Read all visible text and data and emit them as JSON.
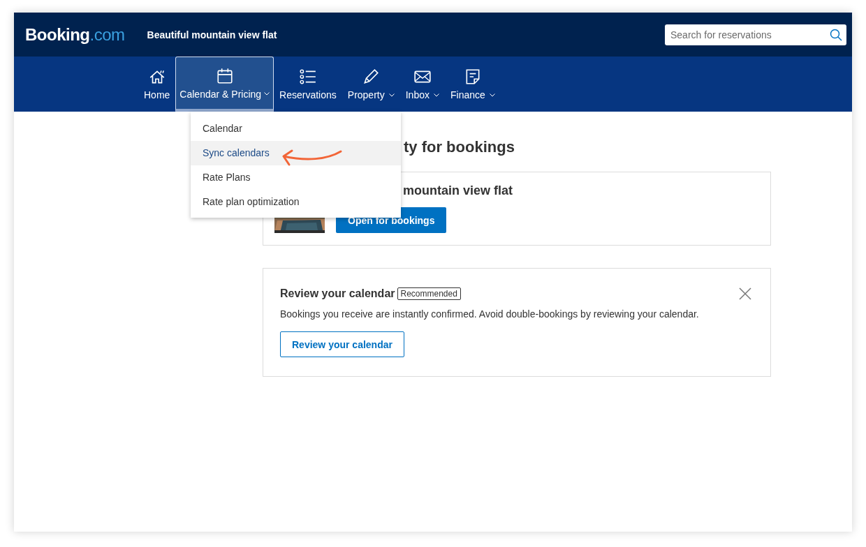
{
  "header": {
    "logo": {
      "name": "Booking",
      "suffix": ".com"
    },
    "property_title": "Beautiful mountain view flat",
    "search": {
      "placeholder": "Search for reservations"
    }
  },
  "nav": [
    {
      "label": "Home",
      "dropdown": false,
      "selected": false
    },
    {
      "label": "Calendar & Pricing",
      "dropdown": true,
      "selected": true
    },
    {
      "label": "Reservations",
      "dropdown": false,
      "selected": false
    },
    {
      "label": "Property",
      "dropdown": true,
      "selected": false
    },
    {
      "label": "Inbox",
      "dropdown": true,
      "selected": false
    },
    {
      "label": "Finance",
      "dropdown": true,
      "selected": false
    }
  ],
  "dropdown_menu": [
    {
      "label": "Calendar",
      "selected": false
    },
    {
      "label": "Sync calendars",
      "selected": true
    },
    {
      "label": "Rate Plans",
      "selected": false
    },
    {
      "label": "Rate plan optimization",
      "selected": false
    }
  ],
  "heading": "ty for bookings",
  "property_card": {
    "title": "mountain view flat",
    "button": "Open for bookings"
  },
  "review_card": {
    "title": "Review your calendar",
    "badge": "Recommended",
    "text": "Bookings you receive are instantly confirmed. Avoid double-bookings by reviewing your calendar.",
    "button": "Review your calendar"
  }
}
